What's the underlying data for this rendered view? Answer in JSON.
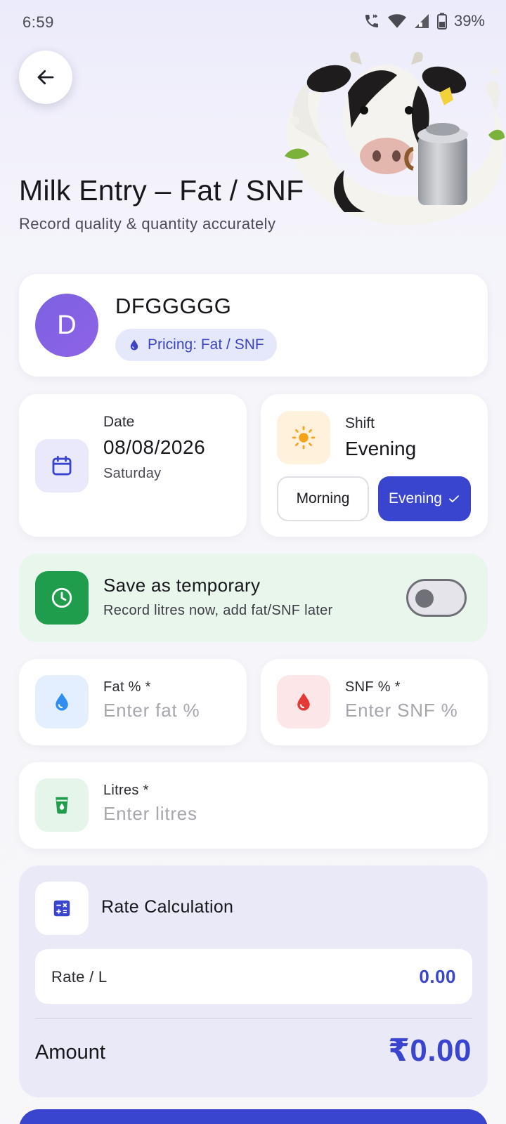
{
  "status_bar": {
    "time": "6:59",
    "battery": "39%"
  },
  "header": {
    "title": "Milk Entry – Fat / SNF",
    "subtitle": "Record quality & quantity accurately"
  },
  "customer": {
    "avatar_letter": "D",
    "name": "DFGGGGG",
    "pricing": "Pricing: Fat / SNF"
  },
  "date": {
    "label": "Date",
    "value": "08/08/2026",
    "day": "Saturday"
  },
  "shift": {
    "label": "Shift",
    "value": "Evening",
    "options": [
      "Morning",
      "Evening"
    ],
    "selected": "Evening"
  },
  "temporary": {
    "title": "Save as temporary",
    "subtitle": "Record litres now, add fat/SNF later",
    "enabled": false
  },
  "fields": {
    "fat": {
      "label": "Fat % *",
      "placeholder": "Enter fat %",
      "value": ""
    },
    "snf": {
      "label": "SNF % *",
      "placeholder": "Enter SNF %",
      "value": ""
    },
    "litres": {
      "label": "Litres *",
      "placeholder": "Enter litres",
      "value": ""
    }
  },
  "rate_calc": {
    "title": "Rate Calculation",
    "rate_label": "Rate / L",
    "rate_value": "0.00",
    "amount_label": "Amount",
    "amount_value": "₹0.00"
  },
  "colors": {
    "primary": "#3a45cf",
    "avatar": "#7b62e0",
    "temporary_bg": "#e8f6ec",
    "temporary_icon": "#1f9d4c",
    "fat_icon": "#2f8ff0",
    "snf_icon": "#e53935",
    "litres_icon": "#1f9d4c",
    "sun_icon": "#f5a31a"
  },
  "icons": {
    "back": "arrow-left-icon",
    "calendar": "calendar-icon",
    "sun": "sun-icon",
    "clock": "clock-icon",
    "fat": "water-drop-icon",
    "snf": "blood-drop-icon",
    "litres": "milk-glass-icon",
    "calculator": "calculator-icon",
    "check": "check-icon",
    "pricing": "drop-icon"
  }
}
